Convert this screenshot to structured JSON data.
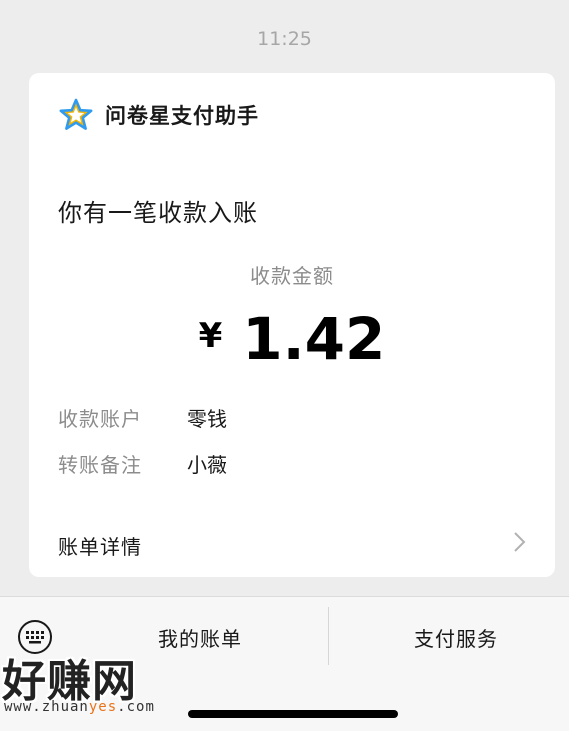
{
  "status": {
    "time": "11:25"
  },
  "card": {
    "app_name": "问卷星支付助手",
    "headline": "你有一笔收款入账",
    "amount_label": "收款金额",
    "currency": "¥",
    "amount": "1.42",
    "rows": [
      {
        "key": "收款账户",
        "value": "零钱"
      },
      {
        "key": "转账备注",
        "value": "小薇"
      }
    ],
    "details_label": "账单详情"
  },
  "bottom_bar": {
    "tab_bills": "我的账单",
    "tab_service": "支付服务"
  },
  "watermark": {
    "big": "好赚网",
    "url_prefix": "www.zhuan",
    "url_highlight": "yes",
    "url_suffix": ".com"
  },
  "icons": {
    "star": "star-icon",
    "chevron": "chevron-right-icon",
    "keyboard": "keyboard-icon"
  },
  "colors": {
    "background": "#ededed",
    "star_blue": "#2f9bf0",
    "star_yellow": "#f5b400"
  }
}
